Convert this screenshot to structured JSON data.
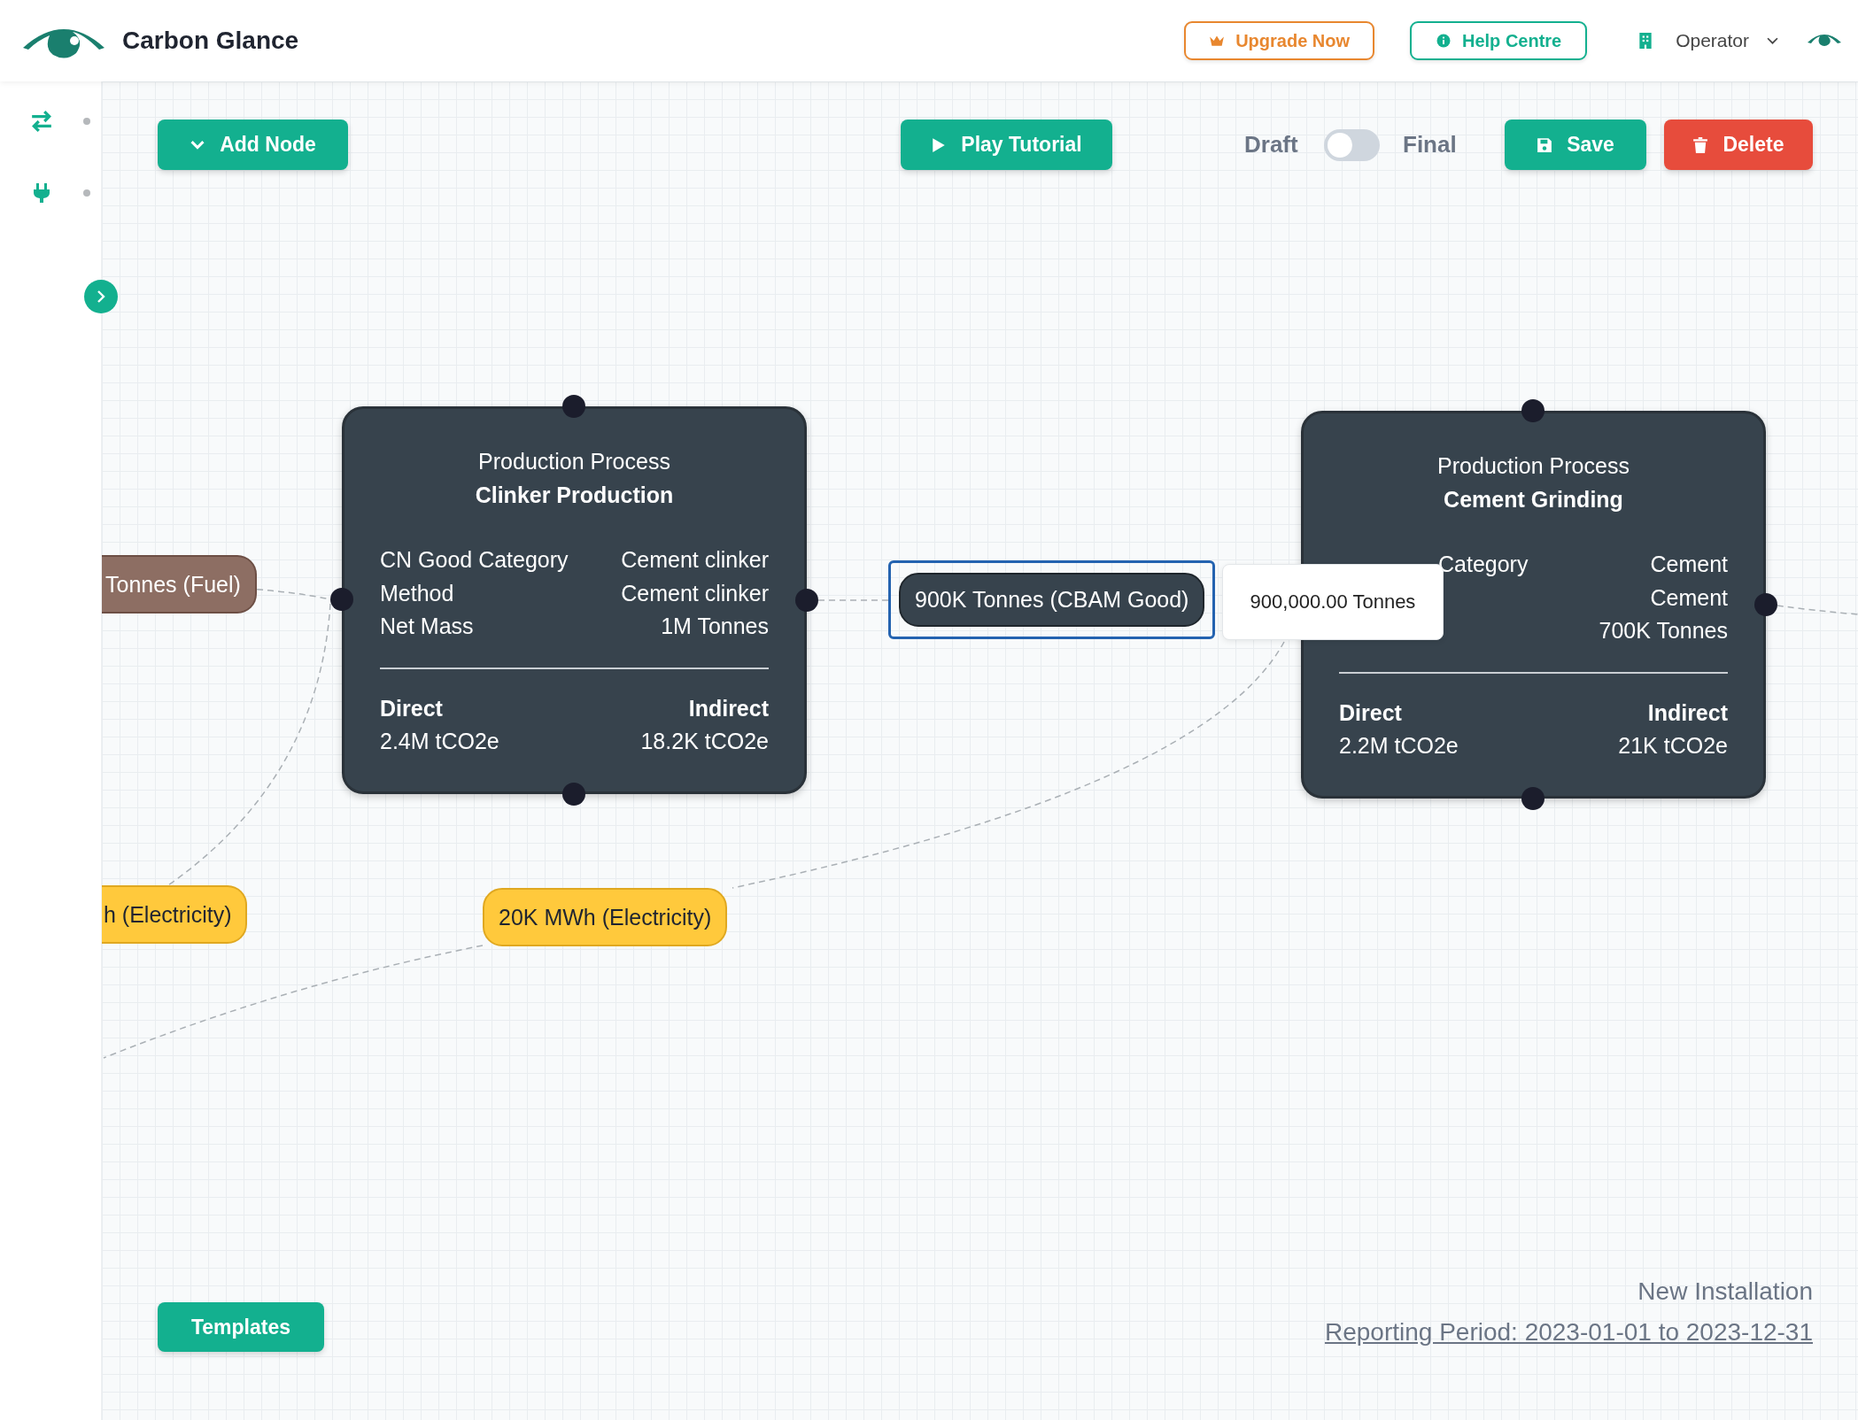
{
  "app": {
    "name": "Carbon Glance"
  },
  "header": {
    "buttons": [
      {
        "kind": "upgrade",
        "label": "Upgrade Now"
      },
      {
        "kind": "help",
        "label": "Help Centre"
      }
    ],
    "user_menu": {
      "label": "Operator"
    }
  },
  "toolbar": {
    "add_node": "Add Node",
    "play_tutorial": "Play Tutorial",
    "mode": {
      "off_label": "Draft",
      "on_label": "Final",
      "on": false
    },
    "save": "Save",
    "delete": "Delete"
  },
  "nodes": [
    {
      "kind": "process",
      "type_label": "Production Process",
      "name": "Clinker Production",
      "rows": [
        {
          "label": "CN Good Category",
          "value": "Cement clinker"
        },
        {
          "label": "Method",
          "value": "Cement clinker"
        },
        {
          "label": "Net Mass",
          "value": "1M Tonnes"
        }
      ],
      "direct_label": "Direct",
      "direct_value": "2.4M tCO2e",
      "indirect_label": "Indirect",
      "indirect_value": "18.2K tCO2e"
    },
    {
      "kind": "process",
      "type_label": "Production Process",
      "name": "Cement Grinding",
      "rows": [
        {
          "label": "Category",
          "value": "Cement"
        },
        {
          "value": "Cement"
        },
        {
          "value": "700K Tonnes"
        }
      ],
      "direct_label": "Direct",
      "direct_value": "2.2M tCO2e",
      "indirect_label": "Indirect",
      "indirect_value": "21K tCO2e"
    }
  ],
  "flows": [
    {
      "kind": "fuel",
      "label": "Tonnes (Fuel)",
      "selected": false
    },
    {
      "kind": "electricity",
      "label": "h (Electricity)",
      "selected": false
    },
    {
      "kind": "good",
      "label": "900K Tonnes (CBAM Good)",
      "selected": true
    },
    {
      "kind": "electricity",
      "label": "20K MWh (Electricity)",
      "selected": false
    }
  ],
  "tooltip": "900,000.00 Tonnes",
  "templates_button": "Templates",
  "footer": {
    "installation": "New Installation",
    "reporting_period": "Reporting Period: 2023-01-01 to 2023-12-31"
  }
}
